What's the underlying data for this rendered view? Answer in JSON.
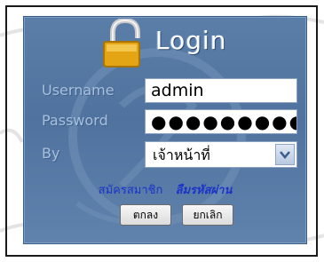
{
  "login": {
    "title": "Login",
    "username_label": "Username",
    "username_value": "admin",
    "password_label": "Password",
    "password_value": "●●●●●●●●●",
    "by_label": "By",
    "by_value": "เจ้าหน้าที่",
    "register_link": "สมัครสมาชิก",
    "forgot_link": "ลืมรหัสผ่าน",
    "ok_button": "ตกลง",
    "cancel_button": "ยกเลิก"
  },
  "icons": {
    "lock": "lock-icon",
    "dropdown": "chevron-down-icon"
  },
  "colors": {
    "panel": "#5b7ea8",
    "label": "#a9c0dc",
    "link": "#1c33c9",
    "lock": "#e4a514"
  }
}
